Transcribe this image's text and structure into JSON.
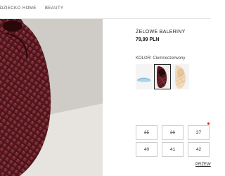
{
  "nav": {
    "items": [
      "DZIECKO",
      "HOME",
      "BEAUTY"
    ]
  },
  "product": {
    "title": "ŻELOWE BALERINY",
    "price": "79,99 PLN",
    "color_label": "KOLOR:",
    "color_value": "Ciemnoczerwony",
    "thumbnail_colors": [
      "light-blue",
      "dark-red",
      "beige"
    ]
  },
  "sizes": [
    {
      "label": "35",
      "available": false
    },
    {
      "label": "36",
      "available": false
    },
    {
      "label": "37",
      "available": true,
      "low_stock": true
    },
    {
      "label": "40",
      "available": true
    },
    {
      "label": "41",
      "available": true
    },
    {
      "label": "42",
      "available": true
    }
  ],
  "size_guide_label": "PRZEW",
  "colors": {
    "shoe": "#5a1a22",
    "low_stock_dot": "#dd1111"
  }
}
